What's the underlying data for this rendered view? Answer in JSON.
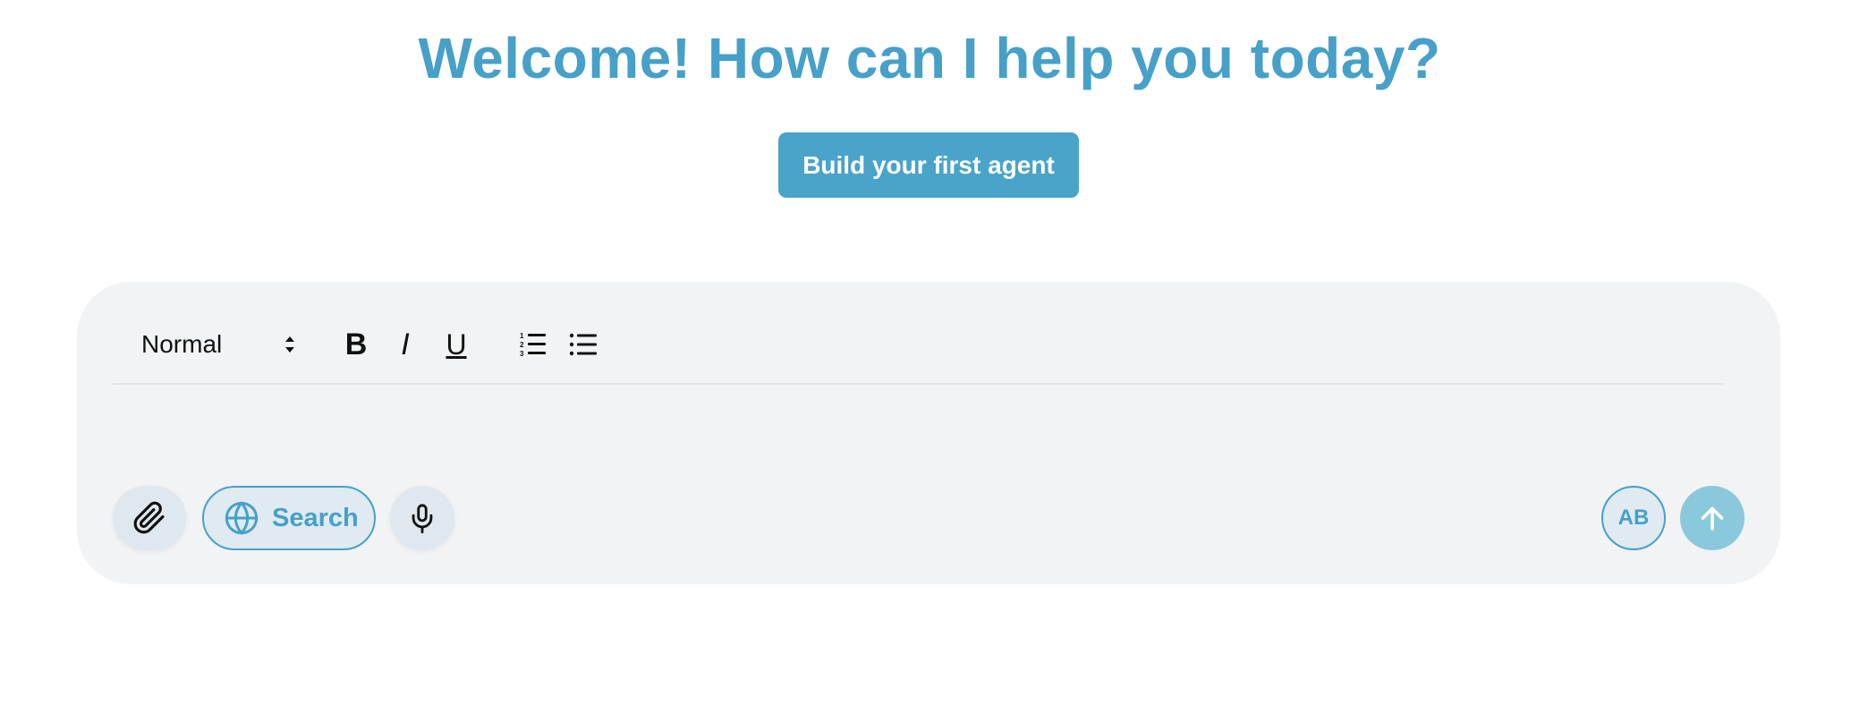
{
  "header": {
    "title": "Welcome! How can I help you today?"
  },
  "cta": {
    "label": "Build your first agent"
  },
  "composer": {
    "toolbar": {
      "format_select_value": "Normal",
      "bold_label": "B",
      "italic_label": "I",
      "underline_label": "U",
      "ordered_list_icon": "ordered-list-icon",
      "bullet_list_icon": "bullet-list-icon"
    },
    "editor": {
      "value": ""
    },
    "actions": {
      "attach_icon": "paperclip-icon",
      "search_label": "Search",
      "search_icon": "globe-icon",
      "mic_icon": "microphone-icon",
      "ab_label": "AB",
      "send_icon": "arrow-up-icon"
    }
  },
  "colors": {
    "accent": "#47a0c8",
    "cta_bg": "#4aa3c9",
    "composer_bg": "#f1f3f5",
    "send_bg": "#8ac8dc"
  }
}
